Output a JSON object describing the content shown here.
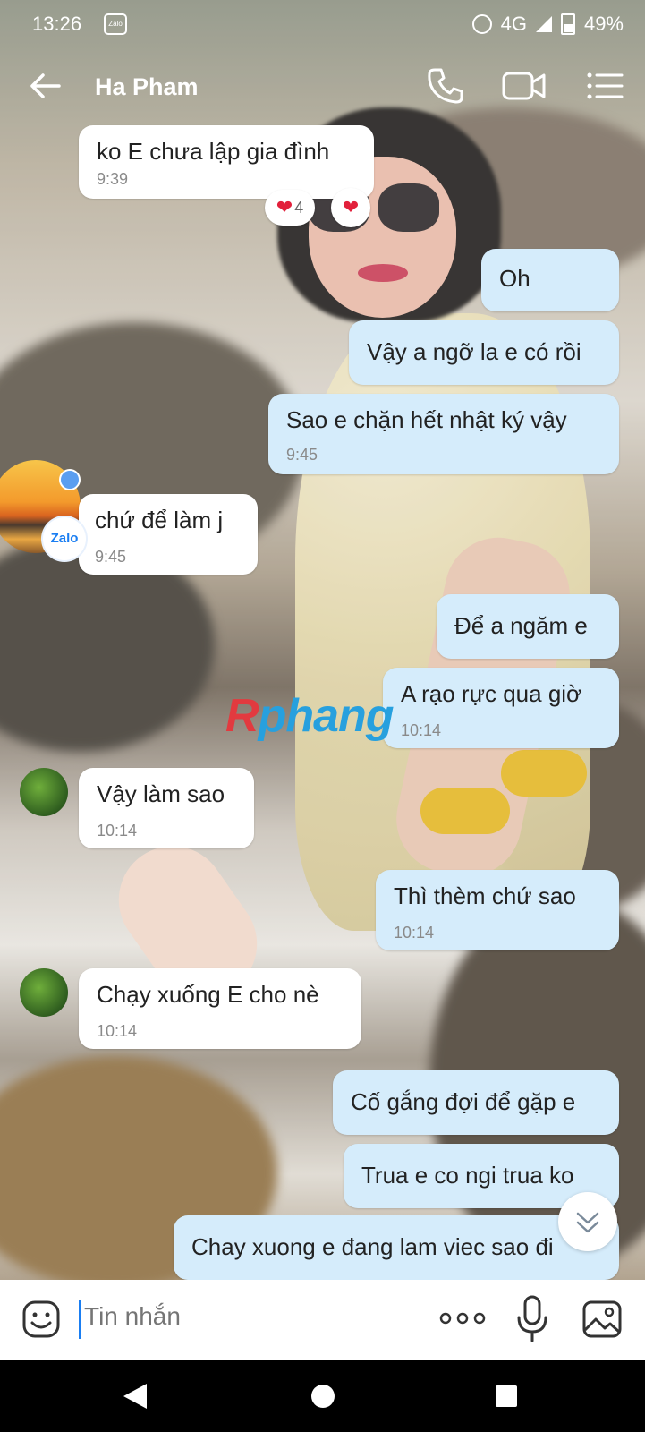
{
  "status_bar": {
    "time": "13:26",
    "network": "4G",
    "battery": "49%",
    "app_icon": "Zalo"
  },
  "header": {
    "contact_name": "Ha Pham"
  },
  "messages": [
    {
      "dir": "in",
      "text": "ko E chưa lập gia đình",
      "time": "9:39"
    },
    {
      "dir": "out",
      "text": "Oh"
    },
    {
      "dir": "out",
      "text": "Vậy a ngỡ la e có rồi"
    },
    {
      "dir": "out",
      "text": "Sao e chặn hết nhật ký vậy",
      "time": "9:45"
    },
    {
      "dir": "in",
      "text": "chứ để làm j",
      "time": "9:45"
    },
    {
      "dir": "out",
      "text": "Để a ngăm e"
    },
    {
      "dir": "out",
      "text": "A rạo rực qua giờ",
      "time": "10:14"
    },
    {
      "dir": "in",
      "text": "Vậy làm sao",
      "time": "10:14"
    },
    {
      "dir": "out",
      "text": "Thì thèm chứ sao",
      "time": "10:14"
    },
    {
      "dir": "in",
      "text": "Chạy xuống E cho nè",
      "time": "10:14"
    },
    {
      "dir": "out",
      "text": "Cố gắng đợi để gặp e"
    },
    {
      "dir": "out",
      "text": "Trua e co ngi trua ko"
    },
    {
      "dir": "out",
      "text": "Chay xuong e đang lam viec sao đi"
    }
  ],
  "reactions": {
    "count": "4"
  },
  "zalo_badge": "Zalo",
  "watermark": {
    "part1": "R",
    "part2": "phang"
  },
  "composer": {
    "placeholder": "Tin nhắn"
  },
  "colors": {
    "accent": "#1a7ef2",
    "outgoing_bubble": "#d5ecfb",
    "incoming_bubble": "#ffffff"
  }
}
